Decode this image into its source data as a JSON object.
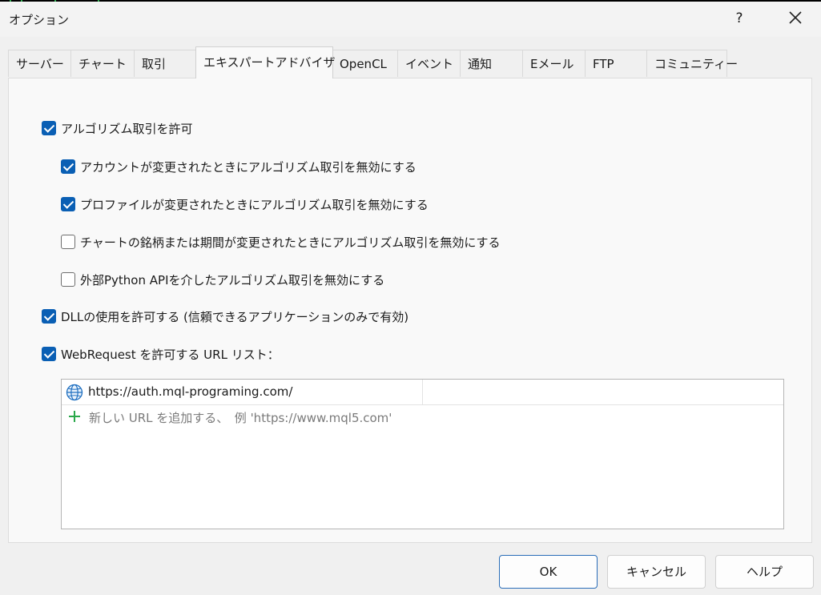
{
  "window": {
    "title": "オプション",
    "help_label": "?"
  },
  "tabs": [
    {
      "label": "サーバー"
    },
    {
      "label": "チャート"
    },
    {
      "label": "取引"
    },
    {
      "label": "エキスパートアドバイザ",
      "active": true
    },
    {
      "label": "OpenCL"
    },
    {
      "label": "イベント"
    },
    {
      "label": "通知"
    },
    {
      "label": "Eメール"
    },
    {
      "label": "FTP"
    },
    {
      "label": "コミュニティー"
    }
  ],
  "options": {
    "algo_trading": {
      "label": "アルゴリズム取引を許可",
      "checked": true
    },
    "disable_on_account_change": {
      "label": "アカウントが変更されたときにアルゴリズム取引を無効にする",
      "checked": true
    },
    "disable_on_profile_change": {
      "label": "プロファイルが変更されたときにアルゴリズム取引を無効にする",
      "checked": true
    },
    "disable_on_symbol_change": {
      "label": "チャートの銘柄または期間が変更されたときにアルゴリズム取引を無効にする",
      "checked": false
    },
    "disable_python_api": {
      "label": "外部Python APIを介したアルゴリズム取引を無効にする",
      "checked": false
    },
    "allow_dll": {
      "label": "DLLの使用を許可する (信頼できるアプリケーションのみで有効)",
      "checked": true
    },
    "allow_webrequest": {
      "label": "WebRequest を許可する URL リスト：",
      "checked": true
    }
  },
  "url_list": {
    "urls": [
      "https://auth.mql-programing.com/"
    ],
    "add_placeholder": "新しい URL を追加する、　例 'https://www.mql5.com'"
  },
  "buttons": {
    "ok": "OK",
    "cancel": "キャンセル",
    "help": "ヘルプ"
  },
  "colors": {
    "accent": "#0a5fb4",
    "add_icon": "#2aa84a"
  }
}
